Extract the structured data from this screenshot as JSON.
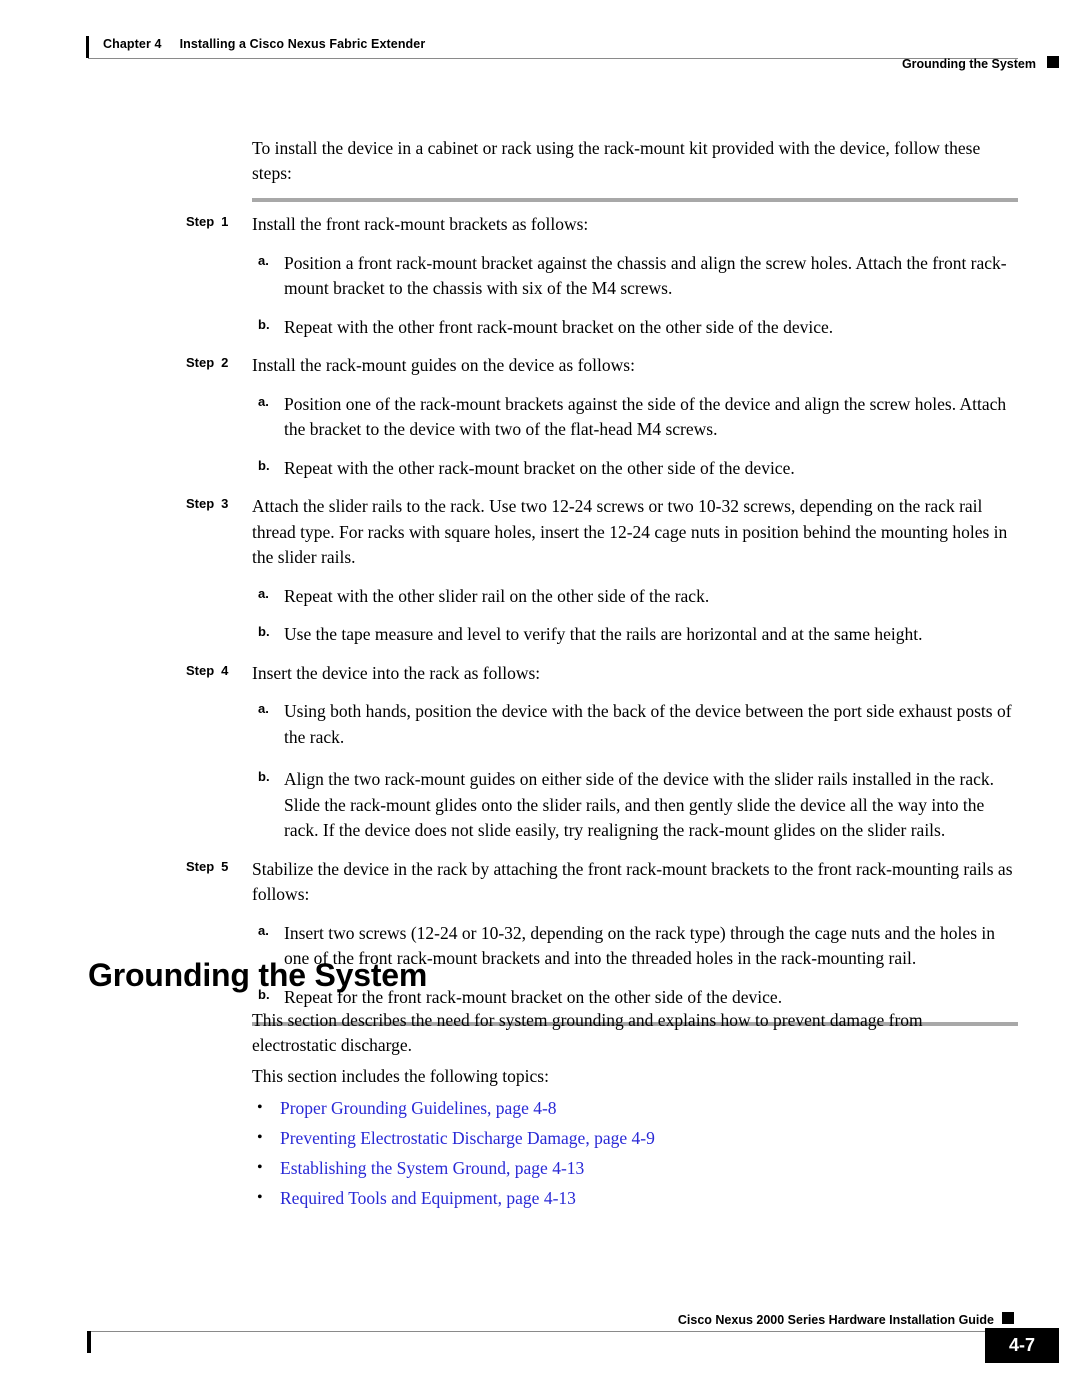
{
  "header": {
    "chapter_label": "Chapter 4",
    "chapter_title": "Installing a Cisco Nexus Fabric Extender",
    "section_title": "Grounding the System",
    "marker_icon": "black-square-marker"
  },
  "intro": {
    "text": "To install the device in a cabinet or rack using the rack-mount kit provided with the device, follow these steps:"
  },
  "steps": [
    {
      "label": "Step",
      "number": "1",
      "text": "Install the front rack-mount brackets as follows:",
      "substeps": [
        {
          "marker": "a.",
          "text": "Position a front rack-mount bracket against the chassis and align the screw holes. Attach the front rack-mount bracket to the chassis with six of the M4 screws."
        },
        {
          "marker": "b.",
          "text": "Repeat with the other front rack-mount bracket on the other side of the device."
        }
      ]
    },
    {
      "label": "Step",
      "number": "2",
      "text": "Install the rack-mount guides on the device as follows:",
      "substeps": [
        {
          "marker": "a.",
          "text": "Position one of the rack-mount brackets against the side of the device and align the screw holes. Attach the bracket to the device with two of the flat-head M4 screws."
        },
        {
          "marker": "b.",
          "text": "Repeat with the other rack-mount bracket on the other side of the device."
        }
      ]
    },
    {
      "label": "Step",
      "number": "3",
      "text": "Attach the slider rails to the rack. Use two 12-24 screws or two 10-32 screws, depending on the rack rail thread type. For racks with square holes, insert the 12-24 cage nuts in position behind the mounting holes in the slider rails.",
      "substeps": [
        {
          "marker": "a.",
          "text": "Repeat with the other slider rail on the other side of the rack."
        },
        {
          "marker": "b.",
          "text": "Use the tape measure and level to verify that the rails are horizontal and at the same height."
        }
      ]
    },
    {
      "label": "Step",
      "number": "4",
      "text": "Insert the device into the rack as follows:",
      "substeps": [
        {
          "marker": "a.",
          "text": "Using both hands, position the device with the back of the device between the port side exhaust posts of the rack."
        },
        {
          "marker": "b.",
          "text": "Align the two rack-mount guides on either side of the device with the slider rails installed in the rack. Slide the rack-mount glides onto the slider rails, and then gently slide the device all the way into the rack. If the device does not slide easily, try realigning the rack-mount glides on the slider rails."
        }
      ]
    },
    {
      "label": "Step",
      "number": "5",
      "text": "Stabilize the device in the rack by attaching the front rack-mount brackets to the front rack-mounting rails as follows:",
      "substeps": [
        {
          "marker": "a.",
          "text": "Insert two screws (12-24 or 10-32, depending on the rack type) through the cage nuts and the holes in one of the front rack-mount brackets and into the threaded holes in the rack-mounting rail."
        },
        {
          "marker": "b.",
          "text": "Repeat for the front rack-mount bracket on the other side of the device."
        }
      ]
    }
  ],
  "section": {
    "heading": "Grounding the System",
    "paragraph_1": "This section describes the need for system grounding and explains how to prevent damage from electrostatic discharge.",
    "paragraph_2": "This section includes the following topics:",
    "link_color": "#2929d6",
    "bullet_glyph": "•",
    "links": [
      {
        "text": "Proper Grounding Guidelines, page 4-8"
      },
      {
        "text": "Preventing Electrostatic Discharge Damage, page 4-9"
      },
      {
        "text": "Establishing the System Ground, page 4-13"
      },
      {
        "text": "Required Tools and Equipment, page 4-13"
      }
    ]
  },
  "footer": {
    "guide_title": "Cisco Nexus 2000 Series Hardware Installation Guide",
    "marker_icon": "black-square-marker",
    "page_number": "4-7"
  }
}
